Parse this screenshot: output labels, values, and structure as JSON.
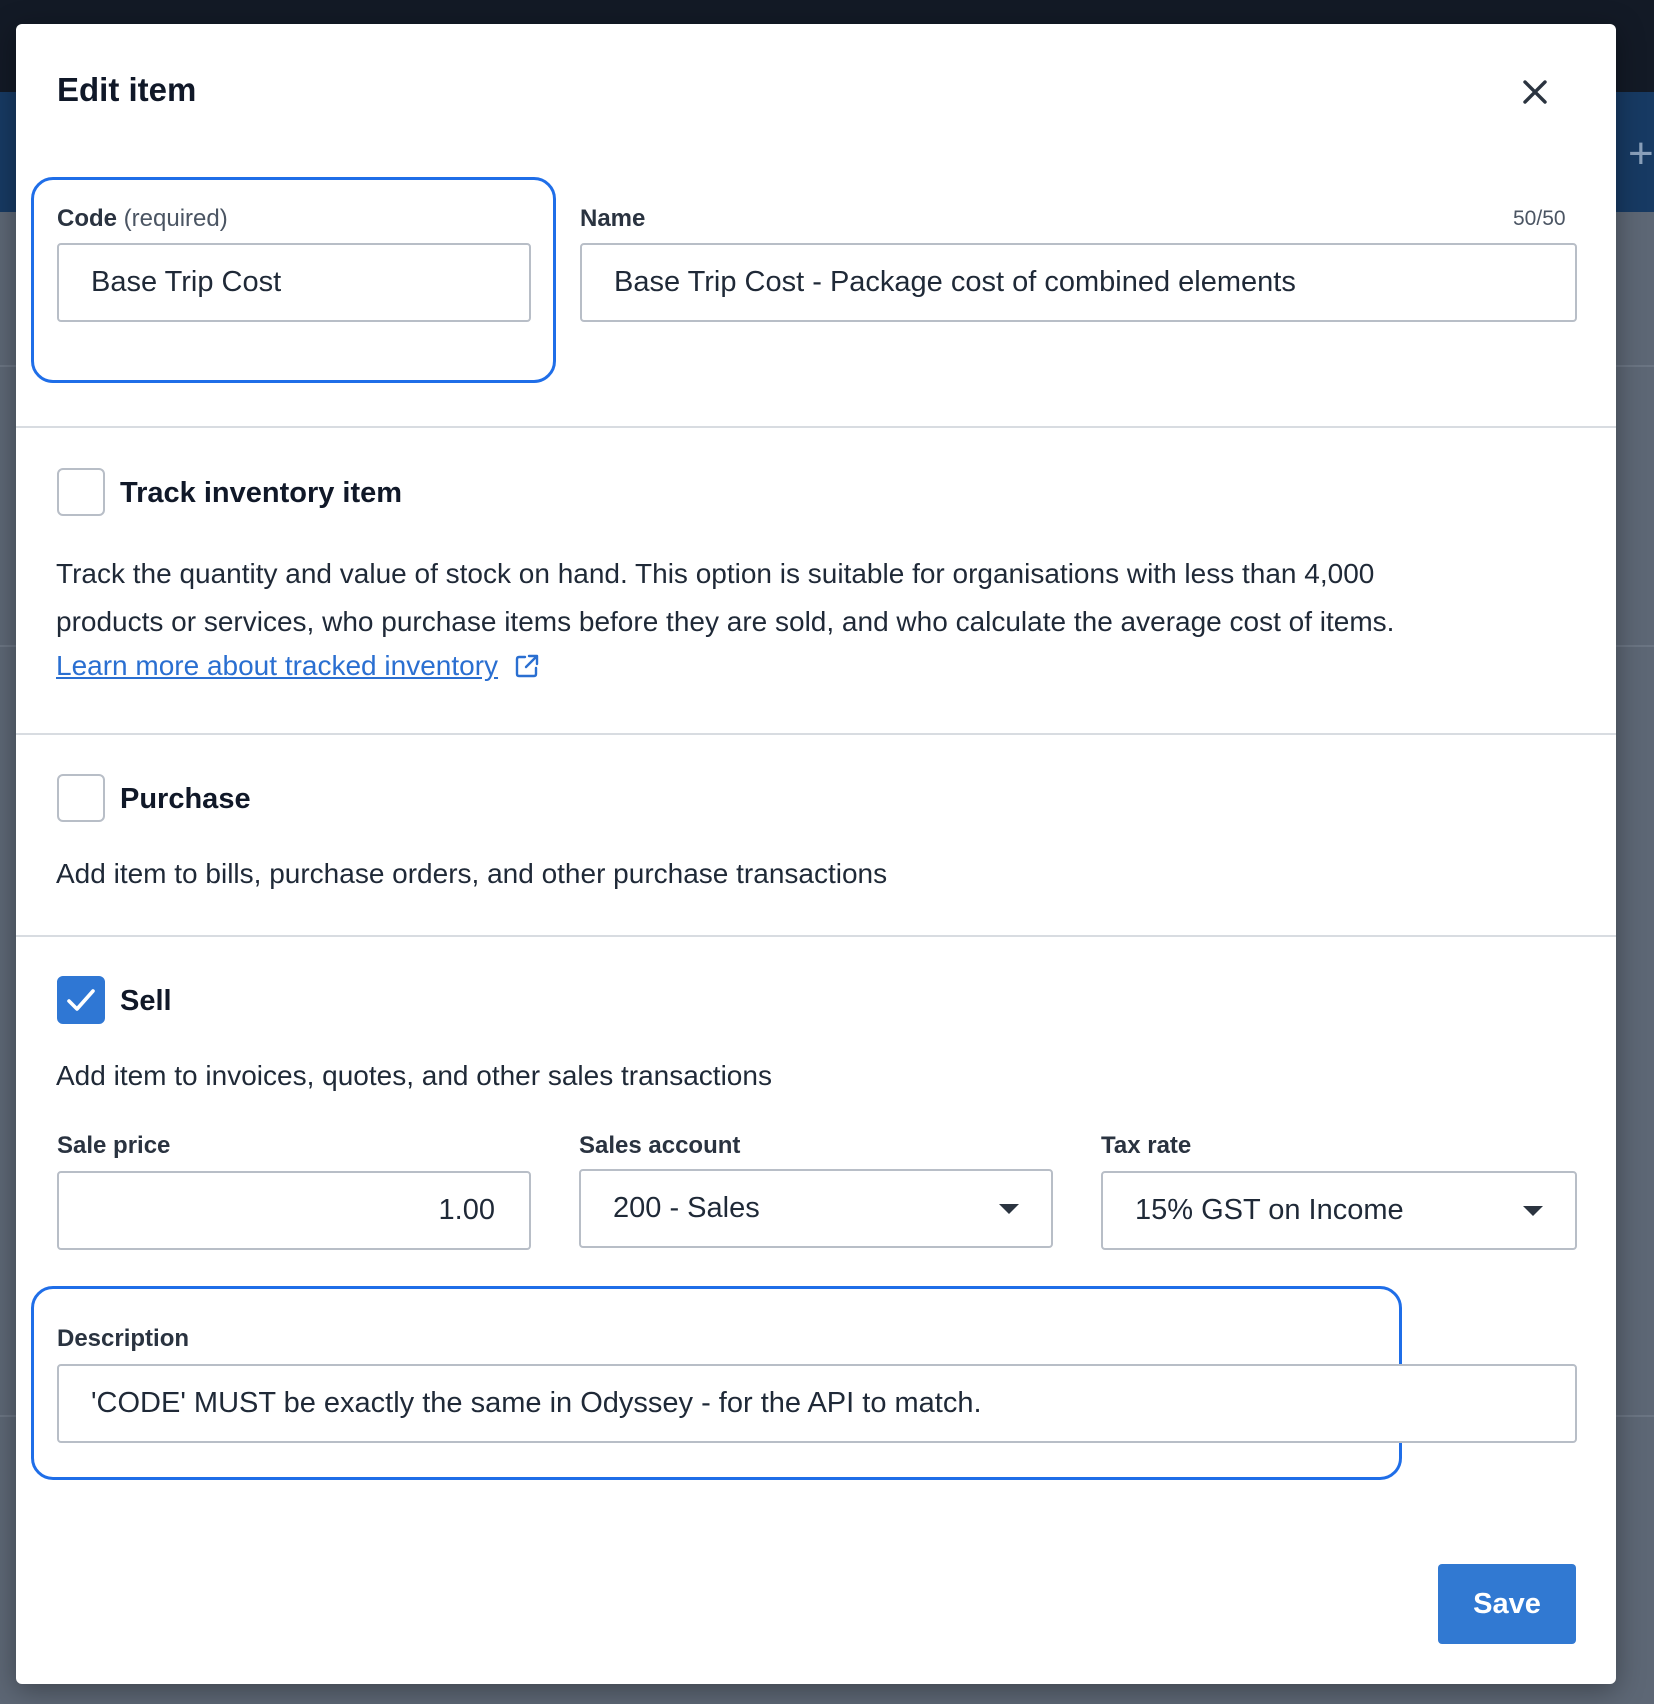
{
  "modal": {
    "title": "Edit item",
    "close_icon": "close-icon",
    "save_label": "Save"
  },
  "code_field": {
    "label": "Code",
    "hint": "(required)",
    "value": "Base Trip Cost"
  },
  "name_field": {
    "label": "Name",
    "counter": "50/50",
    "value": "Base Trip Cost - Package cost of combined elements"
  },
  "track_inventory": {
    "label": "Track inventory item",
    "checked": false,
    "description_line1": "Track the quantity and value of stock on hand. This option is suitable for organisations with less than 4,000",
    "description_line2": "products or services, who purchase items before they are sold, and who calculate the average cost of items.",
    "link_text": "Learn more about tracked inventory",
    "link_icon": "external-link-icon"
  },
  "purchase": {
    "label": "Purchase",
    "checked": false,
    "description": "Add item to bills, purchase orders, and other purchase transactions"
  },
  "sell": {
    "label": "Sell",
    "checked": true,
    "description": "Add item to invoices, quotes, and other sales transactions",
    "sale_price_label": "Sale price",
    "sale_price_value": "1.00",
    "sales_account_label": "Sales account",
    "sales_account_value": "200 - Sales",
    "tax_rate_label": "Tax rate",
    "tax_rate_value": "15% GST on Income",
    "description_label": "Description",
    "description_value": "'CODE' MUST be exactly the same in Odyssey - for the API to match."
  },
  "colors": {
    "accent": "#2f77d4",
    "highlight": "#1f6ee8",
    "link": "#2a6fd1"
  }
}
